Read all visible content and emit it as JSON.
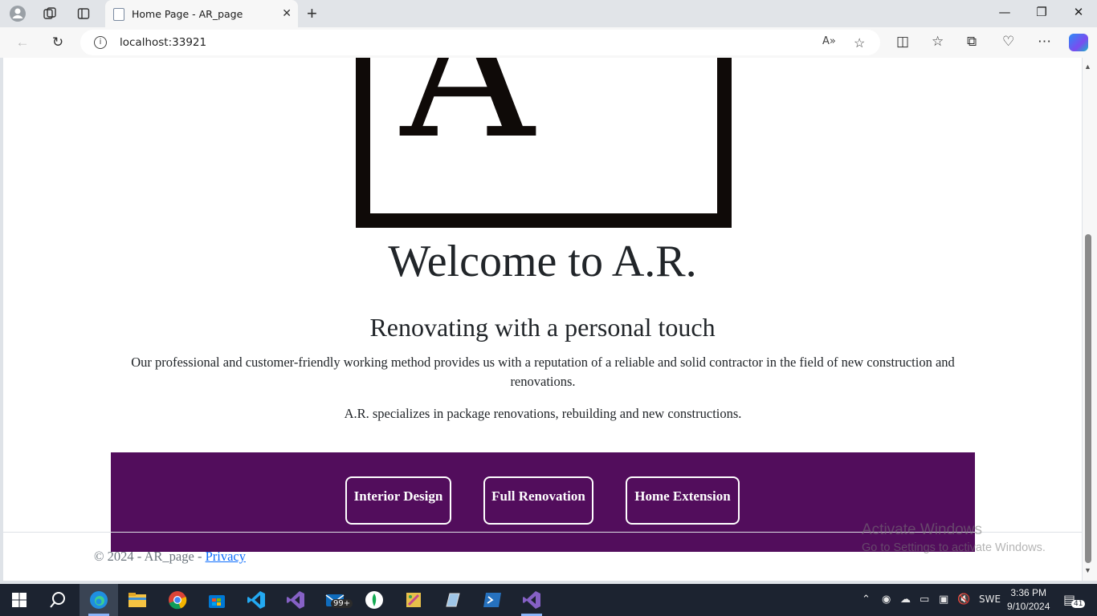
{
  "browser": {
    "tab_title": "Home Page - AR_page",
    "url": "localhost:33921"
  },
  "page": {
    "welcome": "Welcome to A.R.",
    "subtitle": "Renovating with a personal touch",
    "paragraph1": "Our professional and customer-friendly working method provides us with a reputation of a reliable and solid contractor in the field of new construction and renovations.",
    "paragraph2": "A.R. specializes in package renovations, rebuilding and new constructions.",
    "services": [
      "Interior Design",
      "Full Renovation",
      "Home Extension"
    ],
    "footer_text": "© 2024 - AR_page - ",
    "footer_link": "Privacy"
  },
  "watermark": {
    "line1": "Activate Windows",
    "line2": "Go to Settings to activate Windows."
  },
  "taskbar": {
    "mail_badge": "99+",
    "language": "SWE",
    "time": "3:36 PM",
    "date": "9/10/2024",
    "notification_count": "41"
  },
  "colors": {
    "brand_purple": "#520d5c",
    "logo_accent": "#6a0f7a"
  }
}
